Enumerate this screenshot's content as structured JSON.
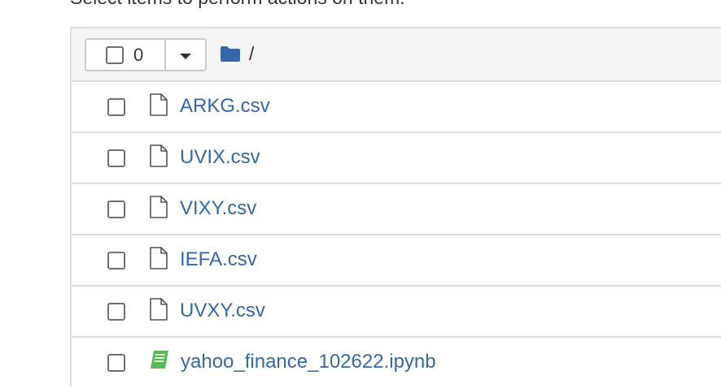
{
  "instructions": "Select items to perform actions on them.",
  "header": {
    "selected_count": "0",
    "breadcrumb_separator": "/"
  },
  "colors": {
    "link": "#3568a8",
    "notebook_icon": "#5cb85c",
    "folder_icon": "#3568a8"
  },
  "files": [
    {
      "name": "ARKG.csv",
      "icon": "file-icon"
    },
    {
      "name": "UVIX.csv",
      "icon": "file-icon"
    },
    {
      "name": "VIXY.csv",
      "icon": "file-icon"
    },
    {
      "name": "IEFA.csv",
      "icon": "file-icon"
    },
    {
      "name": "UVXY.csv",
      "icon": "file-icon"
    },
    {
      "name": "yahoo_finance_102622.ipynb",
      "icon": "notebook-icon"
    }
  ]
}
